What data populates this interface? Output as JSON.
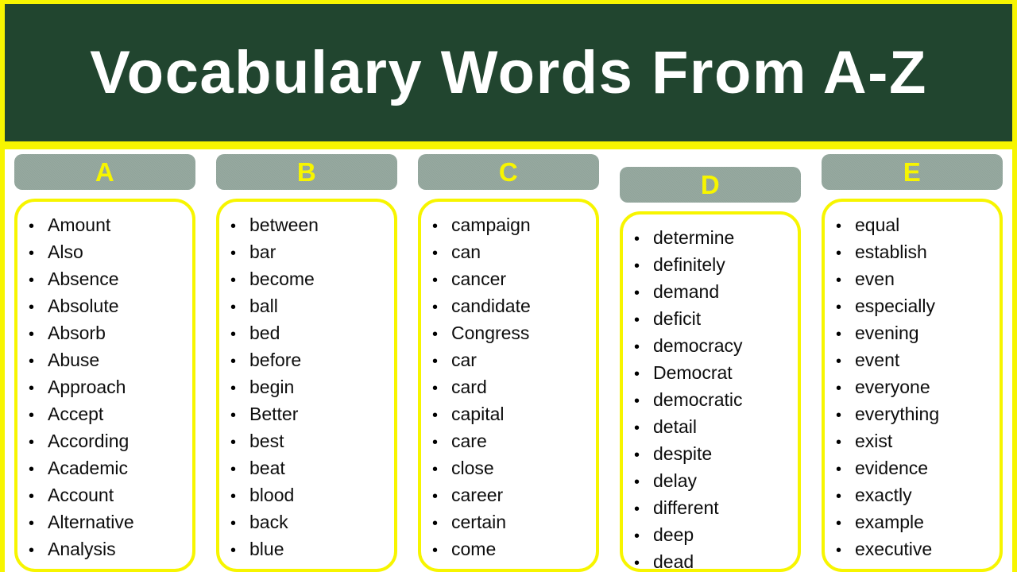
{
  "header": {
    "title": "Vocabulary Words From A-Z"
  },
  "colors": {
    "accent_yellow": "#f7f500",
    "banner_green": "#21452f",
    "header_pill_gray": "#90a49a",
    "title_text": "#ffffff",
    "letter_text": "#f7f500",
    "word_text": "#0d0d0d",
    "card_background": "#ffffff"
  },
  "bullet_glyph": "•",
  "columns": [
    {
      "letter": "A",
      "words": [
        "Amount",
        "Also",
        "Absence",
        "Absolute",
        "Absorb",
        "Abuse",
        "Approach",
        "Accept",
        "According",
        "Academic",
        "Account",
        "Alternative",
        "Analysis"
      ]
    },
    {
      "letter": "B",
      "words": [
        "between",
        "bar",
        "become",
        "ball",
        "bed",
        "before",
        "begin",
        "Better",
        "best",
        "beat",
        "blood",
        "back",
        "blue"
      ]
    },
    {
      "letter": "C",
      "words": [
        "campaign",
        "can",
        "cancer",
        "candidate",
        "Congress",
        "car",
        "card",
        "capital",
        "care",
        "close",
        "career",
        "certain",
        "come"
      ]
    },
    {
      "letter": "D",
      "words": [
        "determine",
        "definitely",
        "demand",
        "deficit",
        "democracy",
        "Democrat",
        "democratic",
        "detail",
        "despite",
        "delay",
        "different",
        "deep",
        "dead"
      ]
    },
    {
      "letter": "E",
      "words": [
        "equal",
        "establish",
        "even",
        "especially",
        "evening",
        "event",
        "everyone",
        "everything",
        "exist",
        "evidence",
        "exactly",
        "example",
        "executive"
      ]
    }
  ]
}
